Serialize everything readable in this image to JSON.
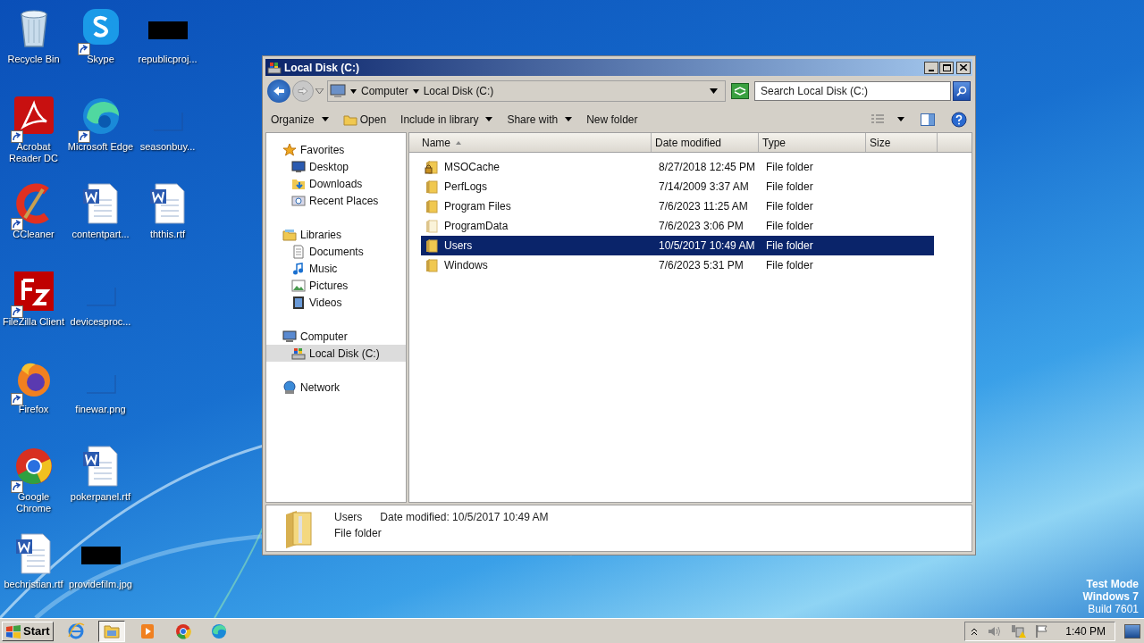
{
  "desktop": {
    "columns": [
      [
        {
          "label": "Recycle Bin",
          "kind": "recycle",
          "shortcut": false
        },
        {
          "label": "Acrobat Reader DC",
          "kind": "acrobat",
          "shortcut": true
        },
        {
          "label": "CCleaner",
          "kind": "ccleaner",
          "shortcut": true
        },
        {
          "label": "FileZilla Client",
          "kind": "filezilla",
          "shortcut": true
        },
        {
          "label": "Firefox",
          "kind": "firefox",
          "shortcut": true
        },
        {
          "label": "Google Chrome",
          "kind": "chrome",
          "shortcut": true
        },
        {
          "label": "bechristian.rtf",
          "kind": "word",
          "shortcut": false
        }
      ],
      [
        {
          "label": "Skype",
          "kind": "skype",
          "shortcut": true
        },
        {
          "label": "Microsoft Edge",
          "kind": "edge",
          "shortcut": true
        },
        {
          "label": "contentpart...",
          "kind": "word",
          "shortcut": false
        },
        {
          "label": "devicesproc...",
          "kind": "blank",
          "shortcut": false
        },
        {
          "label": "finewar.png",
          "kind": "blank",
          "shortcut": false
        },
        {
          "label": "pokerpanel.rtf",
          "kind": "word",
          "shortcut": false
        },
        {
          "label": "providefilm.jpg",
          "kind": "redacted",
          "shortcut": false
        }
      ],
      [
        {
          "label": "republicproj...",
          "kind": "redacted",
          "shortcut": false
        },
        {
          "label": "seasonbuy...",
          "kind": "blank",
          "shortcut": false
        },
        {
          "label": "ththis.rtf",
          "kind": "word",
          "shortcut": false
        }
      ]
    ],
    "os_notice": [
      "Test Mode",
      "Windows 7",
      "Build 7601"
    ]
  },
  "window": {
    "title": "Local Disk (C:)",
    "address": {
      "crumbs": [
        "Computer",
        "Local Disk (C:)"
      ]
    },
    "search": {
      "placeholder": "Search Local Disk (C:)"
    },
    "toolbar": [
      {
        "label": "Organize",
        "dropdown": true,
        "kind": "plain"
      },
      {
        "label": "Open",
        "dropdown": false,
        "kind": "open"
      },
      {
        "label": "Include in library",
        "dropdown": true,
        "kind": "plain"
      },
      {
        "label": "Share with",
        "dropdown": true,
        "kind": "plain"
      },
      {
        "label": "New folder",
        "dropdown": false,
        "kind": "plain"
      }
    ],
    "nav": [
      {
        "label": "Favorites",
        "kind": "star",
        "selected": false,
        "children": [
          {
            "label": "Desktop",
            "kind": "desktop",
            "selected": false
          },
          {
            "label": "Downloads",
            "kind": "downloads",
            "selected": false
          },
          {
            "label": "Recent Places",
            "kind": "recent",
            "selected": false
          }
        ]
      },
      {
        "label": "Libraries",
        "kind": "library",
        "selected": false,
        "children": [
          {
            "label": "Documents",
            "kind": "document",
            "selected": false
          },
          {
            "label": "Music",
            "kind": "music",
            "selected": false
          },
          {
            "label": "Pictures",
            "kind": "pictures",
            "selected": false
          },
          {
            "label": "Videos",
            "kind": "videos",
            "selected": false
          }
        ]
      },
      {
        "label": "Computer",
        "kind": "computer",
        "selected": false,
        "children": [
          {
            "label": "Local Disk (C:)",
            "kind": "drive",
            "selected": true
          }
        ]
      },
      {
        "label": "Network",
        "kind": "network",
        "selected": false
      }
    ],
    "columns": [
      {
        "label": "Name",
        "sorted": true
      },
      {
        "label": "Date modified",
        "sorted": false
      },
      {
        "label": "Type",
        "sorted": false
      },
      {
        "label": "Size",
        "sorted": false
      }
    ],
    "rows": [
      {
        "name": "MSOCache",
        "date": "8/27/2018 12:45 PM",
        "type": "File folder",
        "kind": "locked",
        "selected": false
      },
      {
        "name": "PerfLogs",
        "date": "7/14/2009 3:37 AM",
        "type": "File folder",
        "kind": "folder",
        "selected": false
      },
      {
        "name": "Program Files",
        "date": "7/6/2023 11:25 AM",
        "type": "File folder",
        "kind": "folder",
        "selected": false
      },
      {
        "name": "ProgramData",
        "date": "7/6/2023 3:06 PM",
        "type": "File folder",
        "kind": "hidden",
        "selected": false
      },
      {
        "name": "Users",
        "date": "10/5/2017 10:49 AM",
        "type": "File folder",
        "kind": "folder",
        "selected": true
      },
      {
        "name": "Windows",
        "date": "7/6/2023 5:31 PM",
        "type": "File folder",
        "kind": "folder",
        "selected": false
      }
    ],
    "details": {
      "name": "Users",
      "date_label": "Date modified:",
      "date": "10/5/2017 10:49 AM",
      "type": "File folder"
    }
  },
  "taskbar": {
    "start": "Start",
    "apps": [
      {
        "kind": "ie",
        "active": false
      },
      {
        "kind": "explorer",
        "active": true
      },
      {
        "kind": "media",
        "active": false
      },
      {
        "kind": "chrome",
        "active": false
      },
      {
        "kind": "edge",
        "active": false
      }
    ],
    "time": "1:40 PM"
  }
}
